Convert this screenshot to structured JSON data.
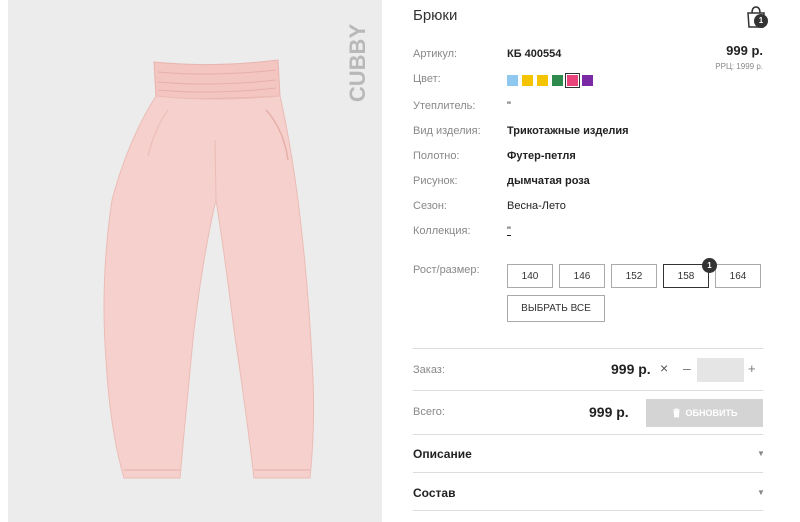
{
  "product": {
    "title": "Брюки",
    "brand": "CUBBY",
    "price": "999 р.",
    "rrp": "РРЦ: 1999 р.",
    "image_color": "#f6d0cc"
  },
  "cart": {
    "count": "1"
  },
  "specs": [
    {
      "label": "Артикул:",
      "value": "КБ 400554"
    },
    {
      "label": "Цвет:",
      "value": ""
    },
    {
      "label": "Утеплитель:",
      "value": "\""
    },
    {
      "label": "Вид изделия:",
      "value": "Трикотажные изделия"
    },
    {
      "label": "Полотно:",
      "value": "Футер-петля"
    },
    {
      "label": "Рисунок:",
      "value": "дымчатая роза"
    },
    {
      "label": "Сезон:",
      "value": "Весна-Лето"
    },
    {
      "label": "Коллекция:",
      "value": "\""
    },
    {
      "label": "Рост/размер:",
      "value": ""
    }
  ],
  "colors": [
    "#8ec8ef",
    "#f5c400",
    "#f5c400",
    "#2f8a4e",
    "#e8437a",
    "#7b2aa6"
  ],
  "selected_color_index": 4,
  "sizes": [
    "140",
    "146",
    "152",
    "158",
    "164"
  ],
  "active_size_index": 3,
  "size_badge": "1",
  "select_all_label": "ВЫБРАТЬ ВСЕ",
  "order": {
    "label": "Заказ:",
    "price": "999 р.",
    "times": "×",
    "minus": "–",
    "plus": "+"
  },
  "total": {
    "label": "Всего:",
    "price": "999 р.",
    "update_label": "ОБНОВИТЬ"
  },
  "accordions": [
    {
      "title": "Описание"
    },
    {
      "title": "Состав"
    }
  ]
}
